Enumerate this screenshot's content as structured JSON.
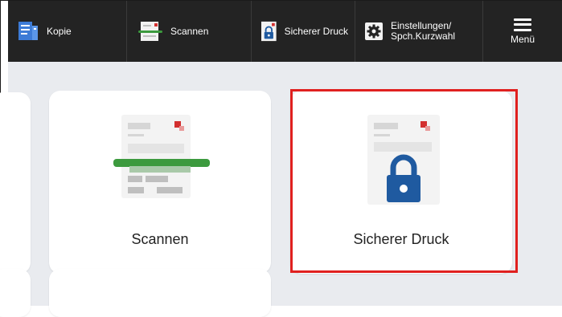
{
  "topbar": {
    "items": [
      {
        "label": "Kopie",
        "icon": "copy-icon"
      },
      {
        "label": "Scannen",
        "icon": "scanner-icon"
      },
      {
        "label": "Sicherer Druck",
        "icon": "lock-document-icon"
      },
      {
        "label": "Einstellungen/\nSpch.Kurzwahl",
        "icon": "gear-icon"
      }
    ],
    "menu_label": "Menü"
  },
  "tiles": {
    "scan_label": "Scannen",
    "secure_label": "Sicherer Druck"
  },
  "colors": {
    "topbar_bg": "#232323",
    "content_bg": "#e9ebef",
    "highlight": "#e0201f",
    "scan_green": "#3c9a3e",
    "lock_blue": "#1f5aa0"
  }
}
